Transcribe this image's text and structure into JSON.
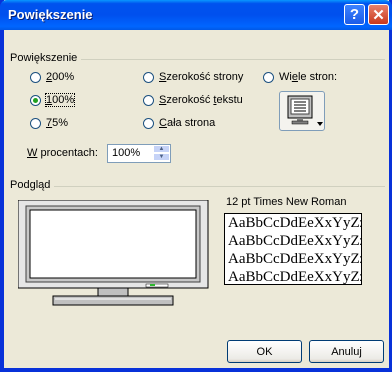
{
  "window": {
    "title": "Powiększenie"
  },
  "zoom_group": {
    "label": "Powiększenie",
    "options": [
      {
        "label": "200%",
        "ul": "2",
        "rest": "00%",
        "selected": false
      },
      {
        "label": "100%",
        "ul": "1",
        "rest": "00%",
        "selected": true
      },
      {
        "label": "75%",
        "ul": "7",
        "rest": "5%",
        "selected": false
      }
    ],
    "fit": [
      {
        "ul": "S",
        "rest": "zerokość strony",
        "label": "Szerokość strony"
      },
      {
        "ul": "S",
        "rest": "zerokość ",
        "ul2": "t",
        "rest2": "ekstu",
        "label": "Szerokość tekstu"
      },
      {
        "ul": "C",
        "rest": "ała strona",
        "label": "Cała strona"
      }
    ],
    "many_pages": {
      "pre": "Wi",
      "ul": "e",
      "rest": "le stron:",
      "label": "Wiele stron:"
    },
    "percent_label_ul": "W",
    "percent_label_rest": " procentach:",
    "percent_value": "100%"
  },
  "preview_group": {
    "label": "Podgląd",
    "font_name": "12 pt Times New Roman",
    "sample_lines": [
      "AaBbCcDdEeXxYyZz",
      "AaBbCcDdEeXxYyZz",
      "AaBbCcDdEeXxYyZz",
      "AaBbCcDdEeXxYyZz"
    ]
  },
  "buttons": {
    "ok": "OK",
    "cancel": "Anuluj"
  },
  "colors": {
    "title_bar": "#0053ee",
    "close": "#c8381c",
    "dialog_bg": "#ece9d8"
  }
}
